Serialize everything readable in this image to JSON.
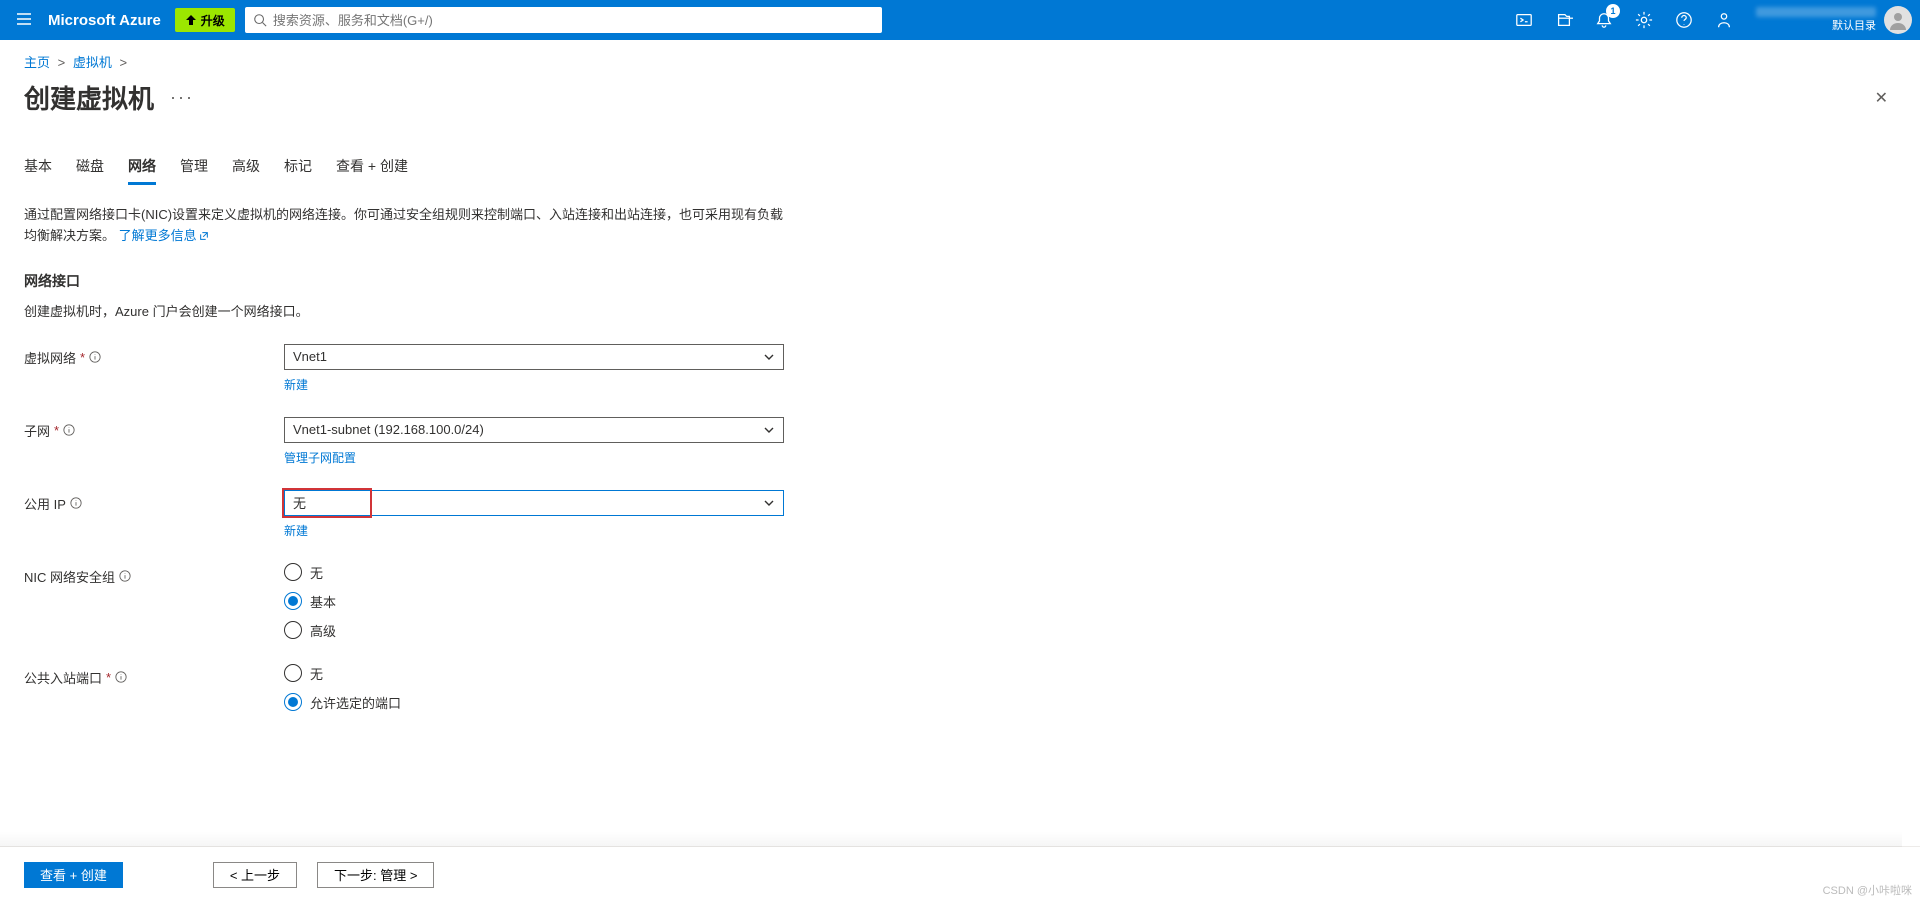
{
  "topbar": {
    "brand": "Microsoft Azure",
    "upgrade_label": "升级",
    "search_placeholder": "搜索资源、服务和文档(G+/)",
    "notification_count": "1",
    "directory_label": "默认目录"
  },
  "breadcrumb": {
    "home": "主页",
    "vm": "虚拟机"
  },
  "page": {
    "title": "创建虚拟机"
  },
  "tabs": [
    "基本",
    "磁盘",
    "网络",
    "管理",
    "高级",
    "标记",
    "查看 + 创建"
  ],
  "active_tab_index": 2,
  "desc": {
    "text1": "通过配置网络接口卡(NIC)设置来定义虚拟机的网络连接。你可通过安全组规则来控制端口、入站连接和出站连接，也可采用现有负载均衡解决方案。",
    "link": "了解更多信息"
  },
  "section": {
    "interface_title": "网络接口",
    "interface_sub": "创建虚拟机时，Azure 门户会创建一个网络接口。"
  },
  "fields": {
    "vnet": {
      "label": "虚拟网络",
      "required": true,
      "value": "Vnet1",
      "sublink": "新建"
    },
    "subnet": {
      "label": "子网",
      "required": true,
      "value": "Vnet1-subnet (192.168.100.0/24)",
      "sublink": "管理子网配置"
    },
    "public_ip": {
      "label": "公用 IP",
      "required": false,
      "value": "无",
      "sublink": "新建"
    },
    "nsg": {
      "label": "NIC 网络安全组",
      "options": [
        "无",
        "基本",
        "高级"
      ],
      "selected": 1
    },
    "inbound": {
      "label": "公共入站端口",
      "required": true,
      "options": [
        "无",
        "允许选定的端口"
      ],
      "selected": 1
    }
  },
  "footer": {
    "review": "查看 + 创建",
    "prev": "< 上一步",
    "next": "下一步: 管理 >"
  },
  "watermark": "CSDN @小咔啦咪"
}
